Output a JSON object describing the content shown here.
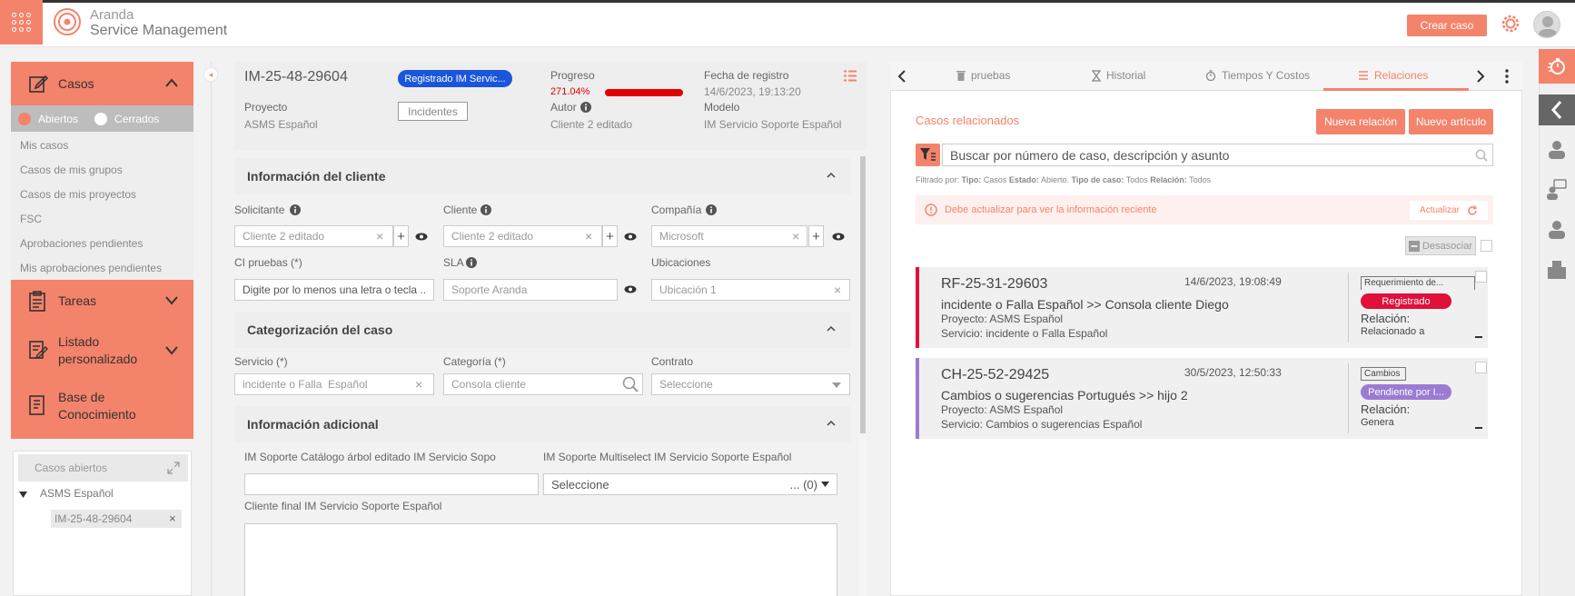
{
  "header": {
    "brand_top": "Aranda",
    "brand_bottom": "Service Management",
    "create_case_button": "Crear caso"
  },
  "sidebar": {
    "casos_label": "Casos",
    "filter_open": "Abiertos",
    "filter_closed": "Cerrados",
    "items": [
      "Mis casos",
      "Casos de mis grupos",
      "Casos de mis proyectos",
      "FSC",
      "Aprobaciones pendientes",
      "Mis aprobaciones pendientes"
    ],
    "tareas_label": "Tareas",
    "listado_label": "Listado\npersonalizado",
    "base_label": "Base de\nConocimiento",
    "open_cases_title": "Casos abiertos",
    "tree_project": "ASMS Español",
    "tree_case": "IM-25-48-29604"
  },
  "case_header": {
    "case_id": "IM-25-48-29604",
    "state_badge": "Registrado IM Servic...",
    "progress_label": "Progreso",
    "progress_value": "271.04%",
    "progress_fraction": 1.0,
    "registration_label": "Fecha de registro",
    "registration_value": "14/6/2023, 19:13:20",
    "project_label": "Proyecto",
    "project_value": "ASMS Español",
    "type_badge": "Incidentes",
    "author_label": "Autor",
    "author_value": "Cliente 2 editado",
    "model_label": "Modelo",
    "model_value": "IM Servicio Soporte Español"
  },
  "client_section": {
    "title": "Información del cliente",
    "solicitante_label": "Solicitante",
    "solicitante_value": "Cliente 2 editado",
    "cliente_label": "Cliente",
    "cliente_value": "Cliente 2 editado",
    "compania_label": "Compañía",
    "compania_value": "Microsoft",
    "ci_label": "CI pruebas (*)",
    "ci_placeholder": "Digite por lo menos una letra o tecla ...",
    "sla_label": "SLA",
    "sla_value": "Soporte Aranda",
    "ubicaciones_label": "Ubicaciones",
    "ubicaciones_value": "Ubicación 1"
  },
  "categorization_section": {
    "title": "Categorización del caso",
    "servicio_label": "Servicio (*)",
    "servicio_value": "incidente o Falla  Español",
    "categoria_label": "Categoría (*)",
    "categoria_value": "Consola cliente",
    "contrato_label": "Contrato",
    "contrato_value": "Seleccione"
  },
  "additional_section": {
    "title": "Información adicional",
    "catalog_label": "IM Soporte Catálogo árbol editado IM Servicio Sopo",
    "multiselect_label": "IM Soporte Multiselect IM Servicio Soporte Español",
    "multiselect_value": "Seleccione",
    "multiselect_count": "... (0)",
    "final_client_label": "Cliente final IM Servicio Soporte Español"
  },
  "right_tabs": [
    "pruebas",
    "Historial",
    "Tiempos Y Costos",
    "Relaciones"
  ],
  "relations": {
    "title": "Casos relacionados",
    "new_relation_button": "Nueva relación",
    "new_article_button": "Nuevo artículo",
    "search_placeholder": "Buscar por número de caso, descripción y asunto",
    "filter_k1": "Filtrado por:",
    "filter_k2": "Tipo:",
    "filter_v2": "Casos",
    "filter_k3": "Estado:",
    "filter_v3": "Abierto.",
    "filter_k4": "Tipo de caso:",
    "filter_v4": "Todos",
    "filter_k5": "Relación:",
    "filter_v5": "Todos",
    "alert_text": "Debe actualizar para ver la información reciente",
    "refresh_label": "Actualizar",
    "disassociate_label": "Desasociar",
    "cards": [
      {
        "id": "RF-25-31-29603",
        "date": "14/6/2023, 19:08:49",
        "subject": "incidente o Falla Español >> Consola cliente Diego",
        "project": "Proyecto: ASMS Español",
        "service": "Servicio: incidente o Falla Español",
        "type": "Requerimiento de...",
        "status": "Registrado",
        "relation_label": "Relación:",
        "relation_value": "Relacionado a",
        "accent": "#e0103a",
        "status_color": "#e0103a"
      },
      {
        "id": "CH-25-52-29425",
        "date": "30/5/2023, 12:50:33",
        "subject": "Cambios o sugerencias Portugués >> hijo 2",
        "project": "Proyecto: ASMS Español",
        "service": "Servicio: Cambios o sugerencias Español",
        "type": "Cambios",
        "status": "Pendiente por I...",
        "relation_label": "Relación:",
        "relation_value": "Genera",
        "accent": "#9b7bd4",
        "status_color": "#9b7bd4"
      }
    ]
  },
  "colors": {
    "accent": "#f4836b",
    "badge_blue": "#1a56db",
    "progress_red": "#e00000"
  }
}
